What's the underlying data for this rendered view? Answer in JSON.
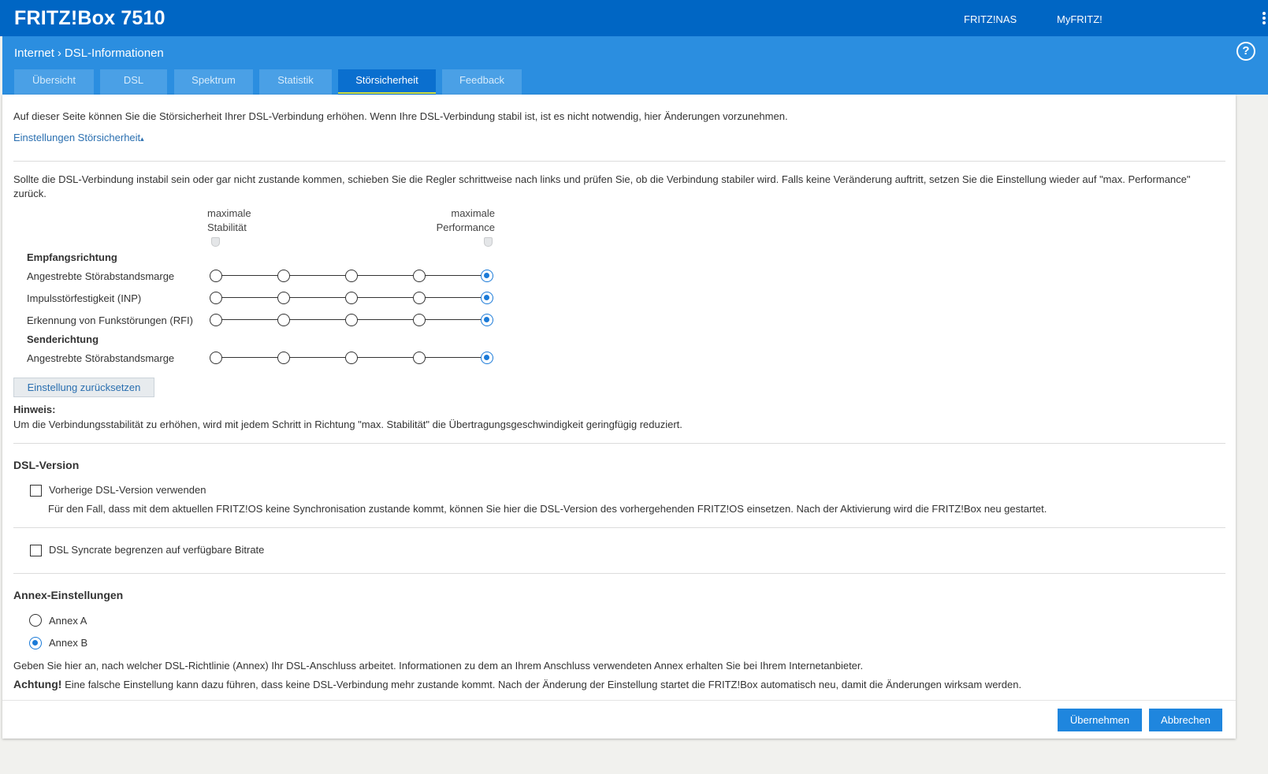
{
  "header": {
    "brand": "FRITZ!Box 7510",
    "links": [
      "FRITZ!NAS",
      "MyFRITZ!"
    ]
  },
  "breadcrumb": {
    "section": "Internet",
    "separator": "›",
    "page": "DSL-Informationen"
  },
  "help": "?",
  "tabs": [
    "Übersicht",
    "DSL",
    "Spektrum",
    "Statistik",
    "Störsicherheit",
    "Feedback"
  ],
  "active_tab": "Störsicherheit",
  "intro": "Auf dieser Seite können Sie die Störsicherheit Ihrer DSL-Verbindung erhöhen. Wenn Ihre DSL-Verbindung stabil ist, ist es nicht notwendig, hier Änderungen vorzunehmen.",
  "settings_toggle": "Einstellungen Störsicherheit",
  "settings_toggle_arrow": "▴",
  "instruction_line1": "Sollte die DSL-Verbindung instabil sein oder gar nicht zustande kommen, schieben Sie die Regler schrittweise nach links und prüfen Sie, ob die Verbindung stabiler wird. Falls keine Veränderung auftritt, setzen Sie die Einstellung wieder auf \"max. Performance\"",
  "instruction_line2": "zurück.",
  "scale": {
    "left_line1": "maximale",
    "left_line2": "Stabilität",
    "right_line1": "maximale",
    "right_line2": "Performance"
  },
  "receive": {
    "heading": "Empfangsrichtung",
    "rows": [
      {
        "label": "Angestrebte Störabstandsmarge",
        "level": 5
      },
      {
        "label": "Impulsstörfestigkeit (INP)",
        "level": 5
      },
      {
        "label": "Erkennung von Funkstörungen (RFI)",
        "level": 5
      }
    ]
  },
  "send": {
    "heading": "Senderichtung",
    "rows": [
      {
        "label": "Angestrebte Störabstandsmarge",
        "level": 5
      }
    ]
  },
  "reset_button": "Einstellung zurücksetzen",
  "hint": {
    "title": "Hinweis:",
    "text": "Um die Verbindungsstabilität zu erhöhen, wird mit jedem Schritt in Richtung \"max. Stabilität\" die Übertragungsgeschwindigkeit geringfügig reduziert."
  },
  "dsl_version": {
    "heading": "DSL-Version",
    "previous_label": "Vorherige DSL-Version verwenden",
    "previous_checked": false,
    "previous_desc": "Für den Fall, dass mit dem aktuellen FRITZ!OS keine Synchronisation zustande kommt, können Sie hier die DSL-Version des vorhergehenden FRITZ!OS einsetzen. Nach der Aktivierung wird die FRITZ!Box neu gestartet.",
    "syncrate_label": "DSL Syncrate begrenzen auf verfügbare Bitrate",
    "syncrate_checked": false
  },
  "annex": {
    "heading": "Annex-Einstellungen",
    "options": [
      "Annex A",
      "Annex B"
    ],
    "selected": "Annex B",
    "info": "Geben Sie hier an, nach welcher DSL-Richtlinie (Annex) Ihr DSL-Anschluss arbeitet. Informationen zu dem an Ihrem Anschluss verwendeten Annex erhalten Sie bei Ihrem Internetanbieter.",
    "warning_label": "Achtung!",
    "warning_text": "Eine falsche Einstellung kann dazu führen, dass keine DSL-Verbindung mehr zustande kommt. Nach der Änderung der Einstellung startet die FRITZ!Box automatisch neu, damit die Änderungen wirksam werden."
  },
  "buttons": {
    "apply": "Übernehmen",
    "cancel": "Abbrechen"
  },
  "colors": {
    "topbar": "#0066c4",
    "subbar": "#2b8ee0",
    "accent": "#1f86de",
    "tab_underline": "#d7e13a"
  }
}
